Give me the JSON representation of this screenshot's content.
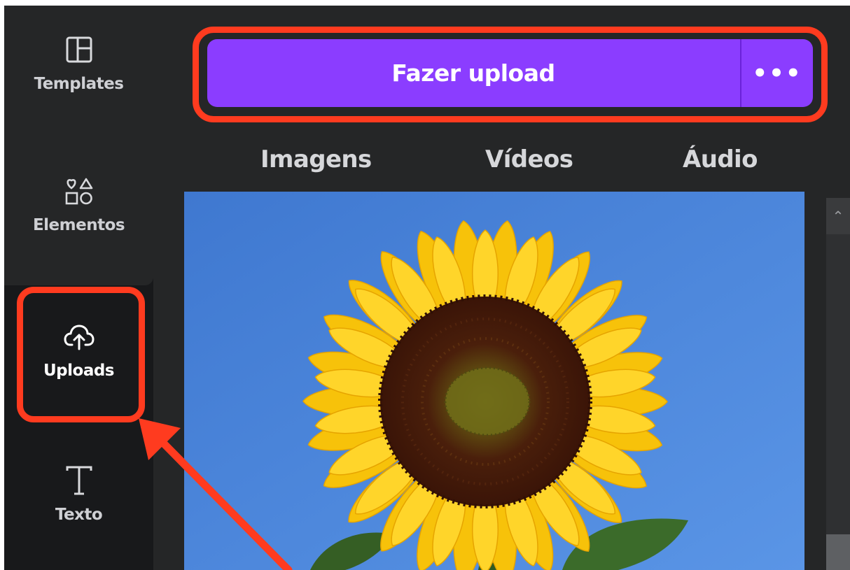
{
  "sidebar": {
    "items": [
      {
        "label": "Templates",
        "icon": "templates-icon"
      },
      {
        "label": "Elementos",
        "icon": "elements-icon"
      },
      {
        "label": "Uploads",
        "icon": "cloud-upload-icon",
        "active": true
      },
      {
        "label": "Texto",
        "icon": "text-icon"
      }
    ]
  },
  "panel": {
    "upload_button": {
      "label": "Fazer upload",
      "more_label": "•••"
    },
    "tabs": [
      {
        "label": "Imagens"
      },
      {
        "label": "Vídeos"
      },
      {
        "label": "Áudio"
      }
    ],
    "uploaded_image": {
      "subject": "sunflower"
    }
  },
  "colors": {
    "accent": "#8b3dff",
    "annotation": "#ff3b1f",
    "background": "#18191b",
    "panel": "#252627"
  }
}
